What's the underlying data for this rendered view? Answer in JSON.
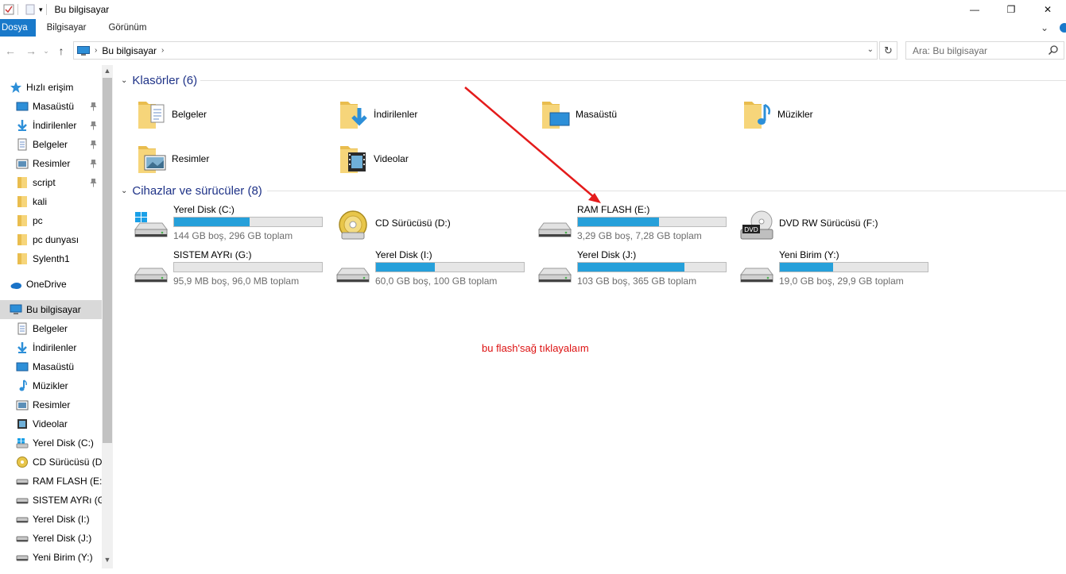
{
  "window": {
    "title": "Bu bilgisayar",
    "minimize": "—",
    "restore": "❐",
    "close": "✕"
  },
  "ribbon": {
    "tabs": [
      "Dosya",
      "Bilgisayar",
      "Görünüm"
    ],
    "collapse": "⌄"
  },
  "address": {
    "path_item": "Bu bilgisayar",
    "chevron": "›",
    "dropdown": "⌄",
    "refresh": "↻",
    "back": "←",
    "forward": "→",
    "recent": "⌄",
    "up": "↑"
  },
  "search": {
    "placeholder": "Ara: Bu bilgisayar"
  },
  "nav": {
    "items": [
      {
        "label": "Hızlı erişim",
        "icon": "star-icon",
        "pinned": false
      },
      {
        "label": "Masaüstü",
        "icon": "desktop-icon",
        "pinned": true
      },
      {
        "label": "İndirilenler",
        "icon": "download-icon",
        "pinned": true
      },
      {
        "label": "Belgeler",
        "icon": "document-icon",
        "pinned": true
      },
      {
        "label": "Resimler",
        "icon": "picture-icon",
        "pinned": true
      },
      {
        "label": "script",
        "icon": "folder-icon",
        "pinned": true
      },
      {
        "label": "kali",
        "icon": "folder-icon",
        "pinned": false
      },
      {
        "label": "pc",
        "icon": "folder-icon",
        "pinned": false
      },
      {
        "label": "pc dunyası",
        "icon": "folder-icon",
        "pinned": false
      },
      {
        "label": "Sylenth1",
        "icon": "folder-icon",
        "pinned": false
      },
      {
        "label": "OneDrive",
        "icon": "cloud-icon",
        "pinned": false
      },
      {
        "label": "Bu bilgisayar",
        "icon": "computer-icon",
        "pinned": false
      },
      {
        "label": "Belgeler",
        "icon": "document-icon",
        "pinned": false
      },
      {
        "label": "İndirilenler",
        "icon": "download-icon",
        "pinned": false
      },
      {
        "label": "Masaüstü",
        "icon": "desktop-icon",
        "pinned": false
      },
      {
        "label": "Müzikler",
        "icon": "music-icon",
        "pinned": false
      },
      {
        "label": "Resimler",
        "icon": "picture-icon",
        "pinned": false
      },
      {
        "label": "Videolar",
        "icon": "video-icon",
        "pinned": false
      },
      {
        "label": "Yerel Disk (C:)",
        "icon": "windows-drive-icon",
        "pinned": false
      },
      {
        "label": "CD Sürücüsü (D:",
        "icon": "cd-drive-icon",
        "pinned": false
      },
      {
        "label": "RAM FLASH (E:)",
        "icon": "drive-icon",
        "pinned": false
      },
      {
        "label": "SISTEM AYRı (G:)",
        "icon": "drive-icon",
        "pinned": false
      },
      {
        "label": "Yerel Disk (I:)",
        "icon": "drive-icon",
        "pinned": false
      },
      {
        "label": "Yerel Disk (J:)",
        "icon": "drive-icon",
        "pinned": false
      },
      {
        "label": "Yeni Birim (Y:)",
        "icon": "drive-icon",
        "pinned": false
      }
    ],
    "selected_index": 11
  },
  "groups": {
    "folders_title": "Klasörler (6)",
    "devices_title": "Cihazlar ve sürücüler (8)",
    "collapse_glyph": "⌄"
  },
  "folders": [
    {
      "label": "Belgeler",
      "overlay": "document"
    },
    {
      "label": "İndirilenler",
      "overlay": "download"
    },
    {
      "label": "Masaüstü",
      "overlay": "desktop"
    },
    {
      "label": "Müzikler",
      "overlay": "music"
    },
    {
      "label": "Resimler",
      "overlay": "picture"
    },
    {
      "label": "Videolar",
      "overlay": "video"
    }
  ],
  "drives": [
    {
      "name": "Yerel Disk (C:)",
      "info": "144 GB boş, 296 GB toplam",
      "used_fraction": 0.51,
      "icon": "windows-drive-icon"
    },
    {
      "name": "CD Sürücüsü (D:)",
      "info": "",
      "used_fraction": null,
      "icon": "cd-drive-icon"
    },
    {
      "name": "RAM FLASH (E:)",
      "info": "3,29 GB boş, 7,28 GB toplam",
      "used_fraction": 0.55,
      "icon": "drive-icon"
    },
    {
      "name": "DVD RW Sürücüsü (F:)",
      "info": "",
      "used_fraction": null,
      "icon": "dvd-drive-icon"
    },
    {
      "name": "SISTEM AYRı (G:)",
      "info": "95,9 MB boş, 96,0 MB toplam",
      "used_fraction": 0.0,
      "icon": "drive-icon"
    },
    {
      "name": "Yerel Disk (I:)",
      "info": "60,0 GB boş, 100 GB toplam",
      "used_fraction": 0.4,
      "icon": "drive-icon"
    },
    {
      "name": "Yerel Disk (J:)",
      "info": "103 GB boş, 365 GB toplam",
      "used_fraction": 0.72,
      "icon": "drive-icon"
    },
    {
      "name": "Yeni Birim (Y:)",
      "info": "19,0 GB boş, 29,9 GB toplam",
      "used_fraction": 0.36,
      "icon": "drive-icon"
    }
  ],
  "annotation": {
    "text": "bu flash'sağ tıklayalaım",
    "color": "#dd1111"
  },
  "colors": {
    "accent": "#1979ca",
    "bar_fill": "#26a0da",
    "group_title": "#1e3287"
  }
}
